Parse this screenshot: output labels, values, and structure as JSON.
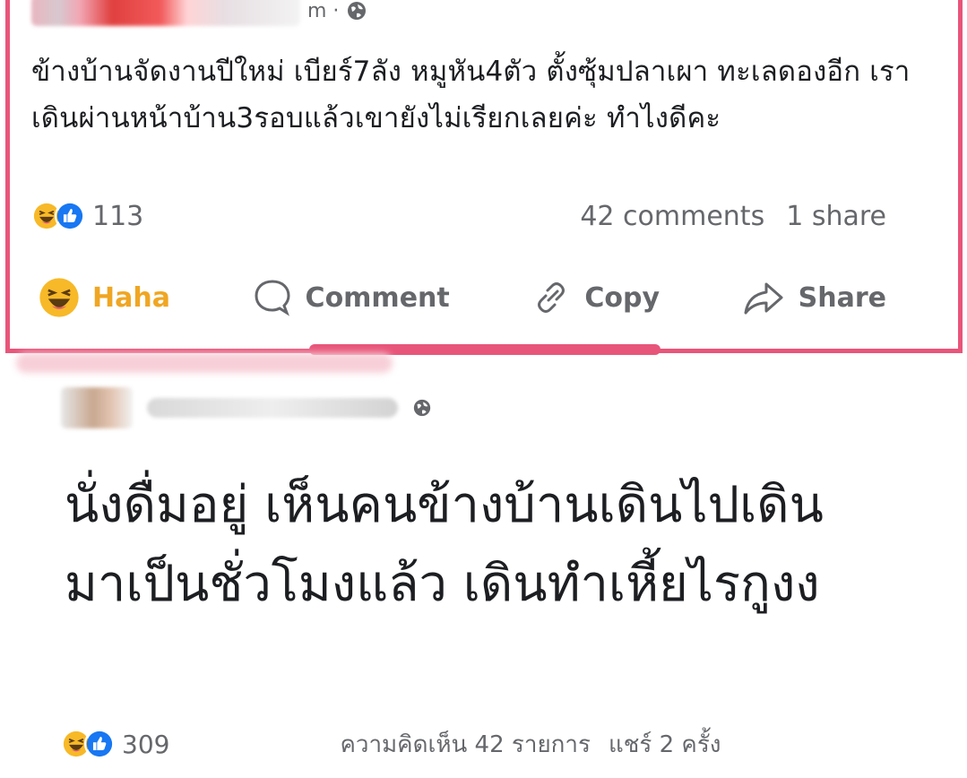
{
  "post": {
    "author_name_blurred": true,
    "time_suffix": "m ·",
    "text": "ข้างบ้านจัดงานปีใหม่ เบียร์7ลัง หมูหัน4ตัว ตั้งซุ้มปลาเผา ทะเลดองอีก เราเดินผ่านหน้าบ้าน3รอบแล้วเขายังไม่เรียกเลยค่ะ ทำไงดีคะ",
    "reactions": [
      "haha",
      "like"
    ],
    "reaction_count": "113",
    "comments": "42 comments",
    "shares": "1 share",
    "actions": {
      "haha": "Haha",
      "comment": "Comment",
      "copy": "Copy",
      "share": "Share"
    }
  },
  "reply_post": {
    "author_name_blurred": true,
    "text": "นั่งดื่มอยู่ เห็นคนข้างบ้านเดินไปเดินมาเป็นชั่วโมงแล้ว เดินทำเหี้ยไรกูงง",
    "reactions": [
      "haha",
      "like"
    ],
    "reaction_count": "309",
    "comments": "ความคิดเห็น 42 รายการ",
    "shares": "แชร์ 2 ครั้ง"
  },
  "colors": {
    "frame": "#e8557a",
    "haha": "#f0a623",
    "like": "#1877f2",
    "muted_text": "#65676b"
  }
}
